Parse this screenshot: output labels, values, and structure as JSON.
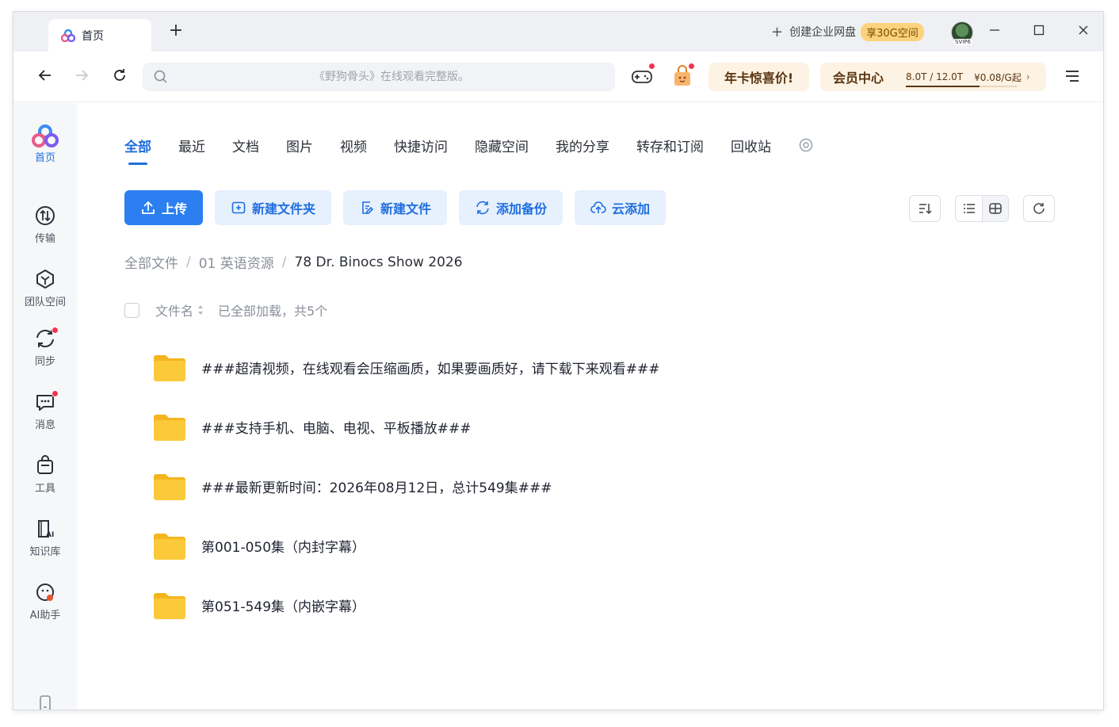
{
  "titlebar": {
    "tab_label": "首页",
    "create_enterprise": "创建企业网盘",
    "create_badge": "享30G空间",
    "avatar_tag": "SVIP6"
  },
  "toolbar": {
    "search_placeholder": "《野狗骨头》在线观看完整版。",
    "promo_label": "年卡惊喜价!",
    "vip_label": "会员中心",
    "quota_text": "8.0T / 12.0T",
    "quota_fraction": 0.667,
    "price_text": "¥0.08/G起"
  },
  "sidebar": {
    "items": [
      {
        "label": "首页",
        "icon": "baidu-netdisk-logo-icon"
      },
      {
        "label": "传输",
        "icon": "transfer-icon"
      },
      {
        "label": "团队空间",
        "icon": "team-space-icon"
      },
      {
        "label": "同步",
        "icon": "sync-icon"
      },
      {
        "label": "消息",
        "icon": "message-icon"
      },
      {
        "label": "工具",
        "icon": "tools-icon"
      },
      {
        "label": "知识库",
        "icon": "knowledge-base-icon"
      },
      {
        "label": "AI助手",
        "icon": "ai-assistant-icon"
      }
    ]
  },
  "main": {
    "tabs": [
      "全部",
      "最近",
      "文档",
      "图片",
      "视频",
      "快捷访问",
      "隐藏空间",
      "我的分享",
      "转存和订阅",
      "回收站"
    ],
    "actions": {
      "upload": "上传",
      "new_folder": "新建文件夹",
      "new_file": "新建文件",
      "add_backup": "添加备份",
      "cloud_add": "云添加"
    },
    "breadcrumb": {
      "root": "全部文件",
      "level1": "01 英语资源",
      "current": "78 Dr. Binocs Show 2026"
    },
    "list_header": {
      "name_col": "文件名",
      "loaded_text": "已全部加载，共5个"
    },
    "files": [
      {
        "name": "###超清视频，在线观看会压缩画质，如果要画质好，请下载下来观看###",
        "type": "folder"
      },
      {
        "name": "###支持手机、电脑、电视、平板播放###",
        "type": "folder"
      },
      {
        "name": "###最新更新时间：2026年08月12日，总计549集###",
        "type": "folder"
      },
      {
        "name": "第001-050集（内封字幕）",
        "type": "folder"
      },
      {
        "name": "第051-549集（内嵌字幕）",
        "type": "folder"
      }
    ]
  },
  "colors": {
    "accent": "#2b7ff0",
    "folder": "#fcc93a",
    "promo_bg": "#fdf3e4",
    "notification": "#f2344e"
  }
}
